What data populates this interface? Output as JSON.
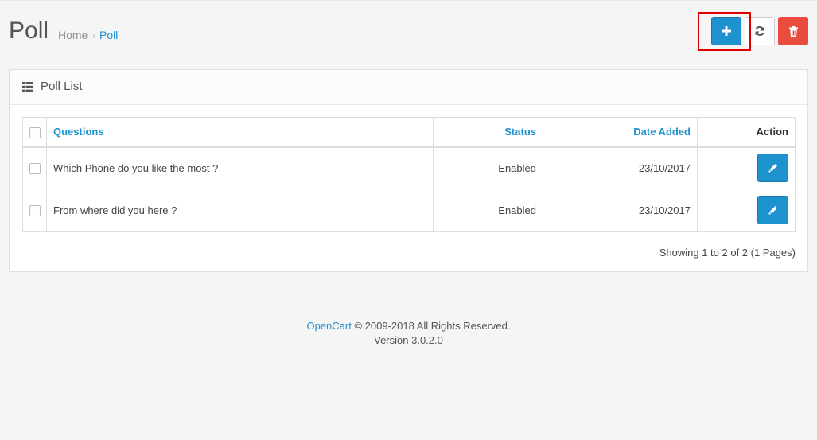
{
  "header": {
    "title": "Poll",
    "breadcrumb": {
      "home": "Home",
      "separator": "›",
      "current": "Poll"
    }
  },
  "toolbar": {
    "add_icon": "plus-icon",
    "refresh_icon": "refresh-icon",
    "delete_icon": "trash-icon"
  },
  "panel": {
    "icon": "list-icon",
    "title": "Poll List"
  },
  "table": {
    "columns": {
      "questions": "Questions",
      "status": "Status",
      "date_added": "Date Added",
      "action": "Action"
    },
    "rows": [
      {
        "question": "Which Phone do you like the most ?",
        "status": "Enabled",
        "date_added": "23/10/2017"
      },
      {
        "question": "From where did you here ?",
        "status": "Enabled",
        "date_added": "23/10/2017"
      }
    ]
  },
  "pagination": {
    "text": "Showing 1 to 2 of 2 (1 Pages)"
  },
  "footer": {
    "brand": "OpenCart",
    "copyright": " © 2009-2018 All Rights Reserved.",
    "version": "Version 3.0.2.0"
  },
  "colors": {
    "primary": "#1e91cf",
    "danger": "#e74c3c",
    "highlight": "#e10000"
  }
}
